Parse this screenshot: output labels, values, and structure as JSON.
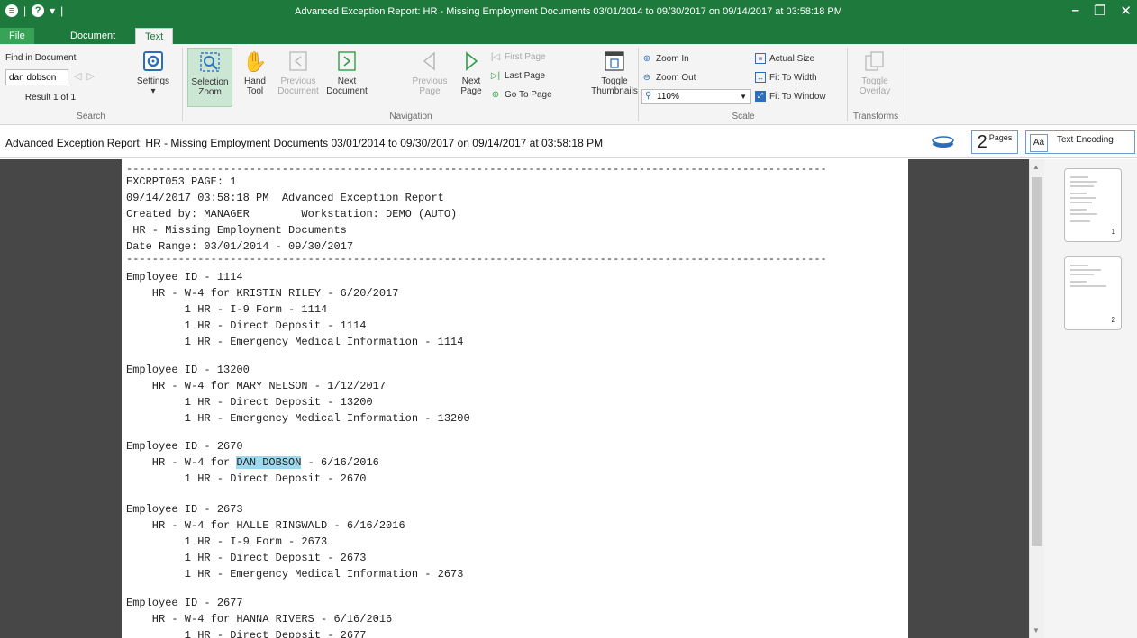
{
  "window": {
    "title": "Advanced Exception Report: HR - Missing Employment Documents 03/01/2014 to 09/30/2017 on 09/14/2017 at 03:58:18 PM"
  },
  "tabs": {
    "file": "File",
    "document": "Document",
    "text": "Text"
  },
  "search": {
    "find_label": "Find in Document",
    "query": "dan dobson",
    "result": "Result 1 of 1",
    "settings": "Settings",
    "group": "Search"
  },
  "navigation": {
    "selection_zoom_1": "Selection",
    "selection_zoom_2": "Zoom",
    "hand_1": "Hand",
    "hand_2": "Tool",
    "prev_doc_1": "Previous",
    "prev_doc_2": "Document",
    "next_doc_1": "Next",
    "next_doc_2": "Document",
    "prev_page_1": "Previous",
    "prev_page_2": "Page",
    "next_page_1": "Next",
    "next_page_2": "Page",
    "first_page": "First Page",
    "last_page": "Last Page",
    "go_to_page": "Go To Page",
    "toggle_thumbs_1": "Toggle",
    "toggle_thumbs_2": "Thumbnails",
    "group": "Navigation"
  },
  "scale": {
    "zoom_in": "Zoom In",
    "zoom_out": "Zoom Out",
    "zoom_value": "110%",
    "actual_size": "Actual Size",
    "fit_width": "Fit To Width",
    "fit_window": "Fit To Window",
    "group": "Scale"
  },
  "transforms": {
    "toggle_overlay_1": "Toggle",
    "toggle_overlay_2": "Overlay",
    "group": "Transforms"
  },
  "doc_header": {
    "title": "Advanced Exception Report: HR - Missing Employment Documents 03/01/2014 to 09/30/2017 on 09/14/2017 at 03:58:18 PM",
    "pages_count": "2",
    "pages_label": "Pages",
    "text_encoding": "Text Encoding",
    "encoding_icon_text": "Aa"
  },
  "report": {
    "rule": "------------------------------------------------------------------------------------------------------------",
    "header": [
      "EXCRPT053 PAGE: 1",
      "09/14/2017 03:58:18 PM  Advanced Exception Report",
      "Created by: MANAGER        Workstation: DEMO (AUTO)",
      " HR - Missing Employment Documents",
      "Date Range: 03/01/2014 - 09/30/2017"
    ],
    "emp1": [
      "Employee ID - 1114",
      "    HR - W-4 for KRISTIN RILEY - 6/20/2017",
      "         1 HR - I-9 Form - 1114",
      "         1 HR - Direct Deposit - 1114",
      "         1 HR - Emergency Medical Information - 1114"
    ],
    "emp2": [
      "Employee ID - 13200",
      "    HR - W-4 for MARY NELSON - 1/12/2017",
      "         1 HR - Direct Deposit - 13200",
      "         1 HR - Emergency Medical Information - 13200"
    ],
    "emp3_id": "Employee ID - 2670",
    "emp3_pre": "    HR - W-4 for ",
    "emp3_hl": "DAN DOBSON",
    "emp3_post": " - 6/16/2016",
    "emp3_dd": "         1 HR - Direct Deposit - 2670",
    "emp4": [
      "Employee ID - 2673",
      "    HR - W-4 for HALLE RINGWALD - 6/16/2016",
      "         1 HR - I-9 Form - 2673",
      "         1 HR - Direct Deposit - 2673",
      "         1 HR - Emergency Medical Information - 2673"
    ],
    "emp5": [
      "Employee ID - 2677",
      "    HR - W-4 for HANNA RIVERS - 6/16/2016",
      "         1 HR - Direct Deposit - 2677"
    ]
  },
  "thumbnails": {
    "page1": "1",
    "page2": "2"
  },
  "colors": {
    "title_bar": "#1e7a3c",
    "highlight": "#9ed8ee",
    "side_gray": "#474747"
  }
}
